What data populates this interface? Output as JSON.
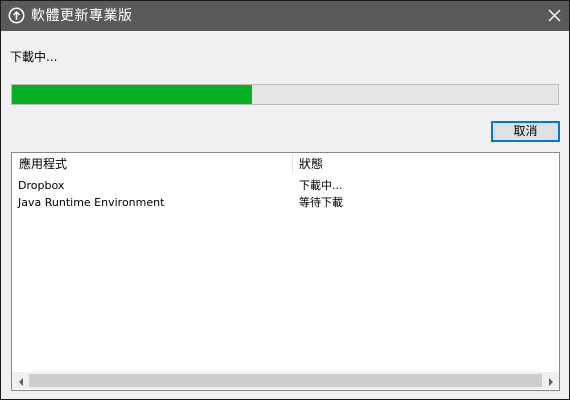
{
  "window": {
    "title": "軟體更新專業版",
    "close_icon": "close-icon",
    "app_icon": "upload-arrow-circle-icon"
  },
  "status": {
    "label": "下載中..."
  },
  "progress": {
    "fraction": 0.44,
    "fill_color": "#06b025",
    "track_color": "#e6e6e6"
  },
  "buttons": {
    "cancel_label": "取消"
  },
  "list": {
    "columns": [
      "應用程式",
      "狀態"
    ],
    "rows": [
      {
        "app": "Dropbox",
        "status": "下載中..."
      },
      {
        "app": "Java Runtime Environment",
        "status": "等待下載"
      }
    ]
  },
  "colors": {
    "titlebar": "#5a5a5a",
    "window_bg": "#f0f0f0",
    "button_border": "#0078d7"
  }
}
